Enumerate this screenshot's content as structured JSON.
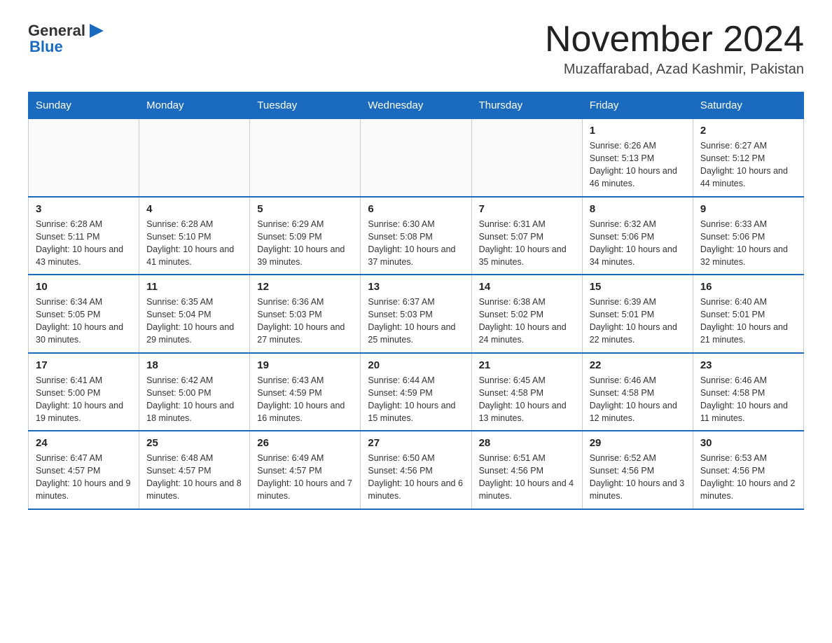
{
  "header": {
    "logo": {
      "general": "General",
      "triangle_icon": "▶",
      "blue": "Blue"
    },
    "title": "November 2024",
    "location": "Muzaffarabad, Azad Kashmir, Pakistan"
  },
  "weekdays": [
    "Sunday",
    "Monday",
    "Tuesday",
    "Wednesday",
    "Thursday",
    "Friday",
    "Saturday"
  ],
  "weeks": [
    [
      {
        "day": "",
        "info": ""
      },
      {
        "day": "",
        "info": ""
      },
      {
        "day": "",
        "info": ""
      },
      {
        "day": "",
        "info": ""
      },
      {
        "day": "",
        "info": ""
      },
      {
        "day": "1",
        "info": "Sunrise: 6:26 AM\nSunset: 5:13 PM\nDaylight: 10 hours and 46 minutes."
      },
      {
        "day": "2",
        "info": "Sunrise: 6:27 AM\nSunset: 5:12 PM\nDaylight: 10 hours and 44 minutes."
      }
    ],
    [
      {
        "day": "3",
        "info": "Sunrise: 6:28 AM\nSunset: 5:11 PM\nDaylight: 10 hours and 43 minutes."
      },
      {
        "day": "4",
        "info": "Sunrise: 6:28 AM\nSunset: 5:10 PM\nDaylight: 10 hours and 41 minutes."
      },
      {
        "day": "5",
        "info": "Sunrise: 6:29 AM\nSunset: 5:09 PM\nDaylight: 10 hours and 39 minutes."
      },
      {
        "day": "6",
        "info": "Sunrise: 6:30 AM\nSunset: 5:08 PM\nDaylight: 10 hours and 37 minutes."
      },
      {
        "day": "7",
        "info": "Sunrise: 6:31 AM\nSunset: 5:07 PM\nDaylight: 10 hours and 35 minutes."
      },
      {
        "day": "8",
        "info": "Sunrise: 6:32 AM\nSunset: 5:06 PM\nDaylight: 10 hours and 34 minutes."
      },
      {
        "day": "9",
        "info": "Sunrise: 6:33 AM\nSunset: 5:06 PM\nDaylight: 10 hours and 32 minutes."
      }
    ],
    [
      {
        "day": "10",
        "info": "Sunrise: 6:34 AM\nSunset: 5:05 PM\nDaylight: 10 hours and 30 minutes."
      },
      {
        "day": "11",
        "info": "Sunrise: 6:35 AM\nSunset: 5:04 PM\nDaylight: 10 hours and 29 minutes."
      },
      {
        "day": "12",
        "info": "Sunrise: 6:36 AM\nSunset: 5:03 PM\nDaylight: 10 hours and 27 minutes."
      },
      {
        "day": "13",
        "info": "Sunrise: 6:37 AM\nSunset: 5:03 PM\nDaylight: 10 hours and 25 minutes."
      },
      {
        "day": "14",
        "info": "Sunrise: 6:38 AM\nSunset: 5:02 PM\nDaylight: 10 hours and 24 minutes."
      },
      {
        "day": "15",
        "info": "Sunrise: 6:39 AM\nSunset: 5:01 PM\nDaylight: 10 hours and 22 minutes."
      },
      {
        "day": "16",
        "info": "Sunrise: 6:40 AM\nSunset: 5:01 PM\nDaylight: 10 hours and 21 minutes."
      }
    ],
    [
      {
        "day": "17",
        "info": "Sunrise: 6:41 AM\nSunset: 5:00 PM\nDaylight: 10 hours and 19 minutes."
      },
      {
        "day": "18",
        "info": "Sunrise: 6:42 AM\nSunset: 5:00 PM\nDaylight: 10 hours and 18 minutes."
      },
      {
        "day": "19",
        "info": "Sunrise: 6:43 AM\nSunset: 4:59 PM\nDaylight: 10 hours and 16 minutes."
      },
      {
        "day": "20",
        "info": "Sunrise: 6:44 AM\nSunset: 4:59 PM\nDaylight: 10 hours and 15 minutes."
      },
      {
        "day": "21",
        "info": "Sunrise: 6:45 AM\nSunset: 4:58 PM\nDaylight: 10 hours and 13 minutes."
      },
      {
        "day": "22",
        "info": "Sunrise: 6:46 AM\nSunset: 4:58 PM\nDaylight: 10 hours and 12 minutes."
      },
      {
        "day": "23",
        "info": "Sunrise: 6:46 AM\nSunset: 4:58 PM\nDaylight: 10 hours and 11 minutes."
      }
    ],
    [
      {
        "day": "24",
        "info": "Sunrise: 6:47 AM\nSunset: 4:57 PM\nDaylight: 10 hours and 9 minutes."
      },
      {
        "day": "25",
        "info": "Sunrise: 6:48 AM\nSunset: 4:57 PM\nDaylight: 10 hours and 8 minutes."
      },
      {
        "day": "26",
        "info": "Sunrise: 6:49 AM\nSunset: 4:57 PM\nDaylight: 10 hours and 7 minutes."
      },
      {
        "day": "27",
        "info": "Sunrise: 6:50 AM\nSunset: 4:56 PM\nDaylight: 10 hours and 6 minutes."
      },
      {
        "day": "28",
        "info": "Sunrise: 6:51 AM\nSunset: 4:56 PM\nDaylight: 10 hours and 4 minutes."
      },
      {
        "day": "29",
        "info": "Sunrise: 6:52 AM\nSunset: 4:56 PM\nDaylight: 10 hours and 3 minutes."
      },
      {
        "day": "30",
        "info": "Sunrise: 6:53 AM\nSunset: 4:56 PM\nDaylight: 10 hours and 2 minutes."
      }
    ]
  ]
}
